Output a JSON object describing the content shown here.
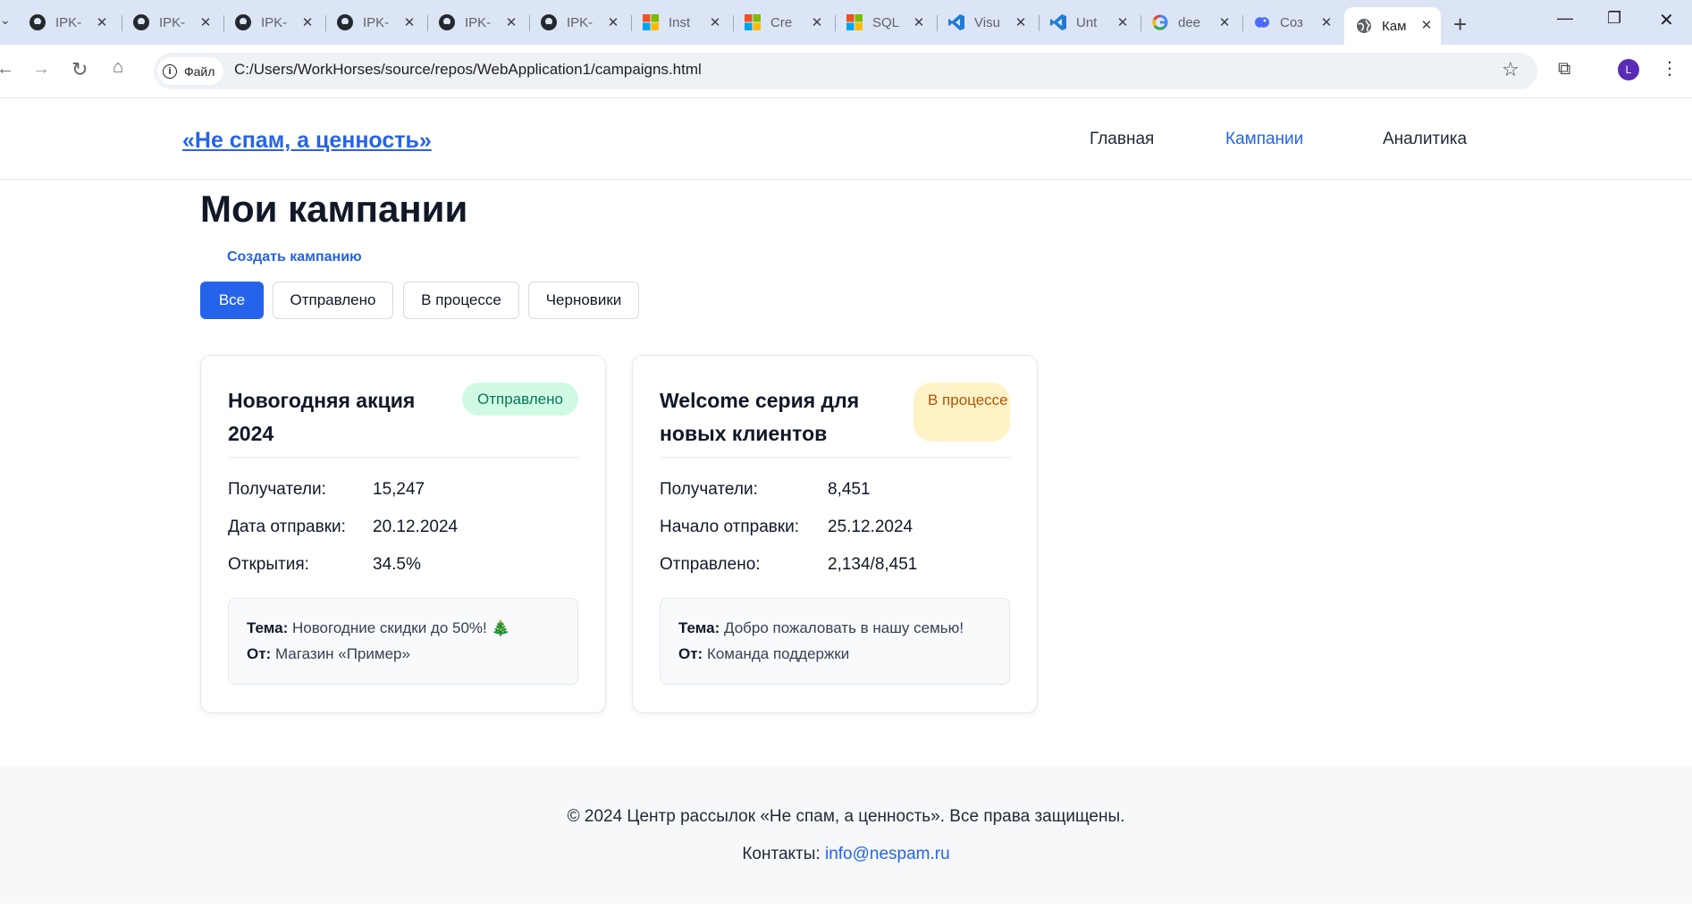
{
  "browser": {
    "tabs": [
      {
        "title": "IPK-",
        "icon": "github-icon"
      },
      {
        "title": "IPK-",
        "icon": "github-icon"
      },
      {
        "title": "IPK-",
        "icon": "github-icon"
      },
      {
        "title": "IPK-",
        "icon": "github-icon"
      },
      {
        "title": "IPK-",
        "icon": "github-icon"
      },
      {
        "title": "IPK-",
        "icon": "github-icon"
      },
      {
        "title": "Inst",
        "icon": "microsoft-icon"
      },
      {
        "title": "Cre",
        "icon": "microsoft-icon"
      },
      {
        "title": "SQL",
        "icon": "microsoft-icon"
      },
      {
        "title": "Visu",
        "icon": "vscode-icon"
      },
      {
        "title": "Unt",
        "icon": "vscode-icon"
      },
      {
        "title": "dee",
        "icon": "google-icon"
      },
      {
        "title": "Соз",
        "icon": "deepseek-icon"
      },
      {
        "title": "Кам",
        "icon": "globe-icon",
        "active": true
      }
    ],
    "site_chip": "Файл",
    "url": "C:/Users/WorkHorses/source/repos/WebApplication1/campaigns.html",
    "profile_initial": "L"
  },
  "header": {
    "logo": "«Не спам, а ценность»",
    "nav": [
      "Главная",
      "Кампании",
      "Аналитика"
    ],
    "active_nav": "Кампании"
  },
  "main": {
    "title": "Мои кампании",
    "create_link": "Создать кампанию",
    "filters": [
      "Все",
      "Отправлено",
      "В процессе",
      "Черновики"
    ],
    "active_filter": "Все",
    "campaigns": [
      {
        "title": "Новогодняя акция 2024",
        "status": "Отправлено",
        "stats": [
          {
            "label": "Получатели:",
            "value": "15,247"
          },
          {
            "label": "Дата отправки:",
            "value": "20.12.2024"
          },
          {
            "label": "Открытия:",
            "value": "34.5%"
          }
        ],
        "subject_label": "Тема:",
        "subject": "Новогодние скидки до 50%! 🎄",
        "from_label": "От:",
        "from": "Магазин «Пример»"
      },
      {
        "title": "Welcome серия для новых клиентов",
        "status": "В процессе",
        "stats": [
          {
            "label": "Получатели:",
            "value": "8,451"
          },
          {
            "label": "Начало отправки:",
            "value": "25.12.2024"
          },
          {
            "label": "Отправлено:",
            "value": "2,134/8,451"
          }
        ],
        "subject_label": "Тема:",
        "subject": "Добро пожаловать в нашу семью!",
        "from_label": "От:",
        "from": "Команда поддержки"
      }
    ]
  },
  "footer": {
    "copyright": "© 2024 Центр рассылок «Не спам, а ценность». Все права защищены.",
    "contacts_label": "Контакты:",
    "email": "info@nespam.ru"
  },
  "colors": {
    "accent": "#2563eb",
    "sent_bg": "#d1fae5",
    "sent_text": "#047857",
    "progress_bg": "#fef3c7",
    "progress_text": "#b45309"
  }
}
